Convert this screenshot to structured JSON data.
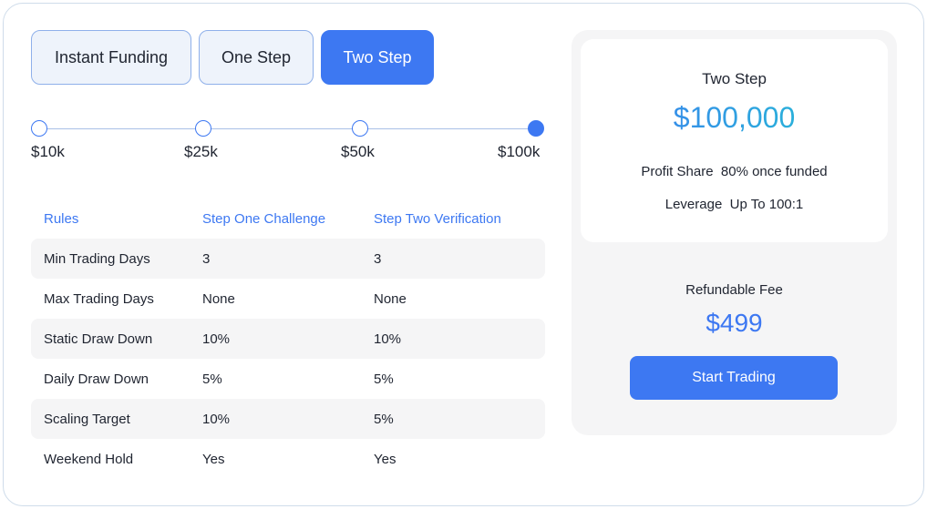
{
  "tabs": [
    {
      "label": "Instant Funding",
      "active": false
    },
    {
      "label": "One Step",
      "active": false
    },
    {
      "label": "Two Step",
      "active": true
    }
  ],
  "account_sizes": [
    {
      "label": "$10k",
      "selected": false
    },
    {
      "label": "$25k",
      "selected": false
    },
    {
      "label": "$50k",
      "selected": false
    },
    {
      "label": "$100k",
      "selected": true
    }
  ],
  "rules_table": {
    "headers": [
      "Rules",
      "Step One Challenge",
      "Step Two Verification"
    ],
    "rows": [
      [
        "Min Trading Days",
        "3",
        "3"
      ],
      [
        "Max Trading Days",
        "None",
        "None"
      ],
      [
        "Static Draw Down",
        "10%",
        "10%"
      ],
      [
        "Daily Draw Down",
        "5%",
        "5%"
      ],
      [
        "Scaling Target",
        "10%",
        "5%"
      ],
      [
        "Weekend Hold",
        "Yes",
        "Yes"
      ]
    ]
  },
  "summary": {
    "plan_name": "Two Step",
    "price": "$100,000",
    "profit_share_label": "Profit Share",
    "profit_share_value": "80% once funded",
    "leverage_label": "Leverage",
    "leverage_value": "Up To 100:1",
    "fee_label": "Refundable Fee",
    "fee_price": "$499",
    "cta_label": "Start Trading"
  },
  "colors": {
    "accent": "#3d78f2",
    "gradient_end": "#22c7d1",
    "tab_bg": "#eef3fb",
    "row_alt_bg": "#f5f5f6"
  }
}
